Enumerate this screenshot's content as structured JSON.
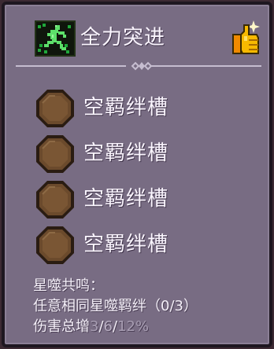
{
  "header": {
    "title": "全力突进",
    "skill_icon": "sprinting-figure-icon",
    "action_icon": "thumbs-up-sparkle-icon"
  },
  "slots": [
    {
      "label": "空羁绊槽",
      "icon": "empty-socket-icon"
    },
    {
      "label": "空羁绊槽",
      "icon": "empty-socket-icon"
    },
    {
      "label": "空羁绊槽",
      "icon": "empty-socket-icon"
    },
    {
      "label": "空羁绊槽",
      "icon": "empty-socket-icon"
    }
  ],
  "resonance": {
    "heading": "星噬共鸣：",
    "requirement_prefix": "任意相同星噬羁绊",
    "requirement_progress": "（0/3）",
    "damage_prefix": "伤害总增",
    "tier_1": "3",
    "sep_1": "/",
    "tier_2": "6",
    "sep_2": "/",
    "tier_3": "12%"
  },
  "colors": {
    "panel_background": "#786c83",
    "panel_border": "#1e1720",
    "text": "#fbf6ff",
    "dim_text": "#a79db2",
    "socket_wood": "#6b4a2c",
    "thumb_gold": "#f7b900"
  }
}
